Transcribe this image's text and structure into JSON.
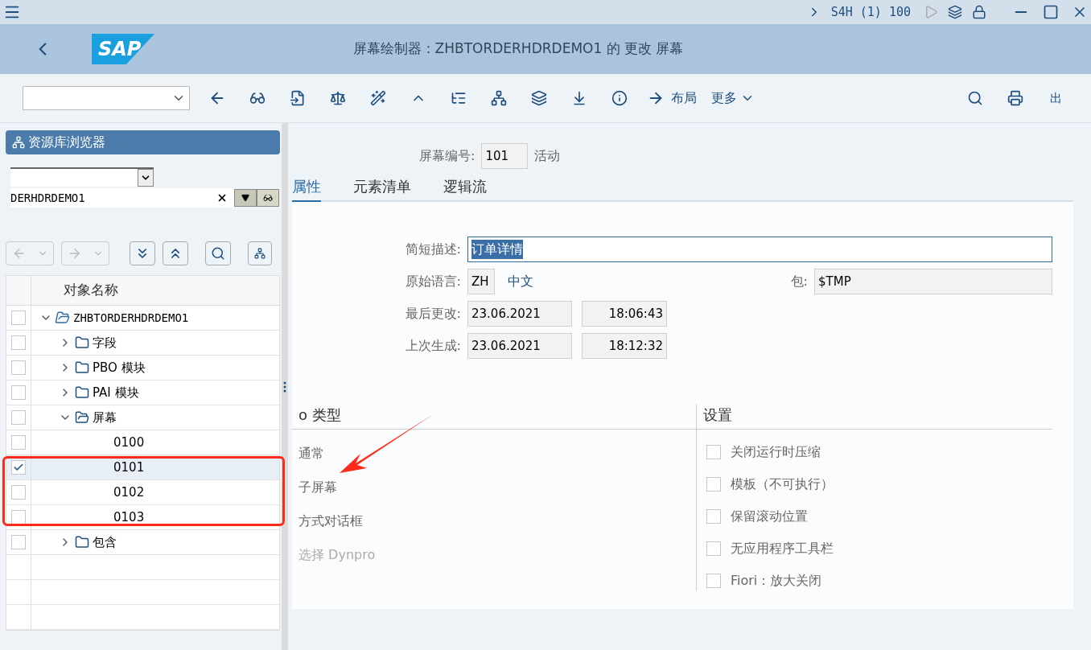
{
  "system_bar": {
    "session": "S4H (1) 100"
  },
  "header": {
    "logo": "SAP",
    "title": "屏幕绘制器：ZHBTORDERHDRDEMO1 的 更改 屏幕"
  },
  "toolbar": {
    "layout_button": "布局",
    "more_button": "更多",
    "exit_button": "出"
  },
  "repository": {
    "title": "资源库浏览器",
    "object_name": "DERHDRDEMO1",
    "column": "对象名称",
    "tree": [
      {
        "label": "ZHBTORDERHDRDEMO1",
        "kind": "root",
        "expanded": true,
        "checked": false,
        "selected": false,
        "children": [
          {
            "label": "字段",
            "kind": "folder",
            "expanded": false,
            "checked": false,
            "selected": false
          },
          {
            "label": "PBO 模块",
            "kind": "folder",
            "expanded": false,
            "checked": false,
            "selected": false
          },
          {
            "label": "PAI 模块",
            "kind": "folder",
            "expanded": false,
            "checked": false,
            "selected": false
          },
          {
            "label": "屏幕",
            "kind": "folder",
            "expanded": true,
            "checked": false,
            "selected": false,
            "children": [
              {
                "label": "0100",
                "kind": "leaf",
                "checked": false,
                "selected": false
              },
              {
                "label": "0101",
                "kind": "leaf",
                "checked": true,
                "selected": true
              },
              {
                "label": "0102",
                "kind": "leaf",
                "checked": false,
                "selected": false
              },
              {
                "label": "0103",
                "kind": "leaf",
                "checked": false,
                "selected": false
              }
            ]
          },
          {
            "label": "包含",
            "kind": "folder",
            "expanded": false,
            "checked": false,
            "selected": false
          }
        ]
      }
    ]
  },
  "screen": {
    "number_label": "屏幕编号:",
    "number": "101",
    "status": "活动",
    "tabs": [
      {
        "label": "属性",
        "selected": true
      },
      {
        "label": "元素清单",
        "selected": false
      },
      {
        "label": "逻辑流",
        "selected": false
      }
    ],
    "description_label": "简短描述:",
    "description": "订单详情",
    "language_label": "原始语言:",
    "language": "ZH",
    "language_name": "中文",
    "package_label": "包:",
    "package": "$TMP",
    "changed_label": "最后更改:",
    "changed_date": "23.06.2021",
    "changed_time": "18:06:43",
    "generated_label": "上次生成:",
    "generated_date": "23.06.2021",
    "generated_time": "18:12:32",
    "type_title": "o 类型",
    "types": [
      {
        "label": "通常",
        "disabled": false
      },
      {
        "label": "子屏幕",
        "disabled": false
      },
      {
        "label": "方式对话框",
        "disabled": false
      },
      {
        "label": "选择 Dynpro",
        "disabled": true
      }
    ],
    "settings_title": "设置",
    "settings": [
      {
        "label": "关闭运行时压缩",
        "checked": false
      },
      {
        "label": "模板（不可执行）",
        "checked": false
      },
      {
        "label": "保留滚动位置",
        "checked": false
      },
      {
        "label": "无应用程序工具栏",
        "checked": false
      },
      {
        "label": "Fiori：放大关闭",
        "checked": false
      }
    ]
  }
}
